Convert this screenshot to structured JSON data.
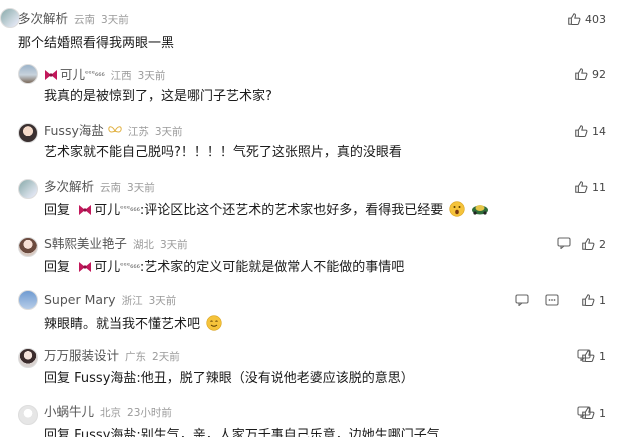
{
  "comments": [
    {
      "username": "多次解析",
      "location": "云南",
      "time": "3天前",
      "likes": "403",
      "text": "那个结婚照看得我两眼一黑"
    },
    {
      "username": "可儿",
      "username_suffix": "ᵉᵉᵉ₆₆₆",
      "location": "江西",
      "time": "3天前",
      "likes": "92",
      "text": "我真的是被惊到了，这是哪门子艺术家?"
    },
    {
      "username": "Fussy海盐",
      "location": "江苏",
      "time": "3天前",
      "likes": "14",
      "text": "艺术家就不能自己脱吗?！！！！气死了这张照片，真的没眼看"
    },
    {
      "username": "多次解析",
      "location": "云南",
      "time": "3天前",
      "likes": "11",
      "reply_prefix": "回复",
      "reply_to": "可儿",
      "reply_to_suffix": "ᵉᵉᵉ₆₆₆",
      "text": ":评论区比这个还艺术的艺术家也好多，看得我已经要"
    },
    {
      "username": "S韩熙美业艳子",
      "location": "湖北",
      "time": "3天前",
      "likes": "2",
      "reply_prefix": "回复",
      "reply_to": "可儿",
      "reply_to_suffix": "ᵉᵉᵉ₆₆₆",
      "text": ":艺术家的定义可能就是做常人不能做的事情吧"
    },
    {
      "username": "Super Mary",
      "location": "浙江",
      "time": "3天前",
      "likes": "1",
      "text": "辣眼睛。就当我不懂艺术吧"
    },
    {
      "username": "万万服装设计",
      "location": "广东",
      "time": "2天前",
      "likes": "1",
      "reply_prefix": "回复",
      "reply_to": "Fussy海盐",
      "text": ":他丑，脱了辣眼（没有说他老婆应该脱的意思）"
    },
    {
      "username": "小蜗牛儿",
      "location": "北京",
      "time": "23小时前",
      "likes": "1",
      "reply_prefix": "回复",
      "reply_to": "Fussy海盐",
      "text": ":别生气，亲，人家万千事自己乐意，边她生哪门子气"
    }
  ],
  "colors": {
    "text": "#1a1a1a",
    "meta": "#9a9a9a",
    "bow": "#c2185b"
  },
  "icons": {
    "like": "thumbs-up-icon",
    "reply": "speech-bubble-icon",
    "decoration": "bow-icon"
  }
}
